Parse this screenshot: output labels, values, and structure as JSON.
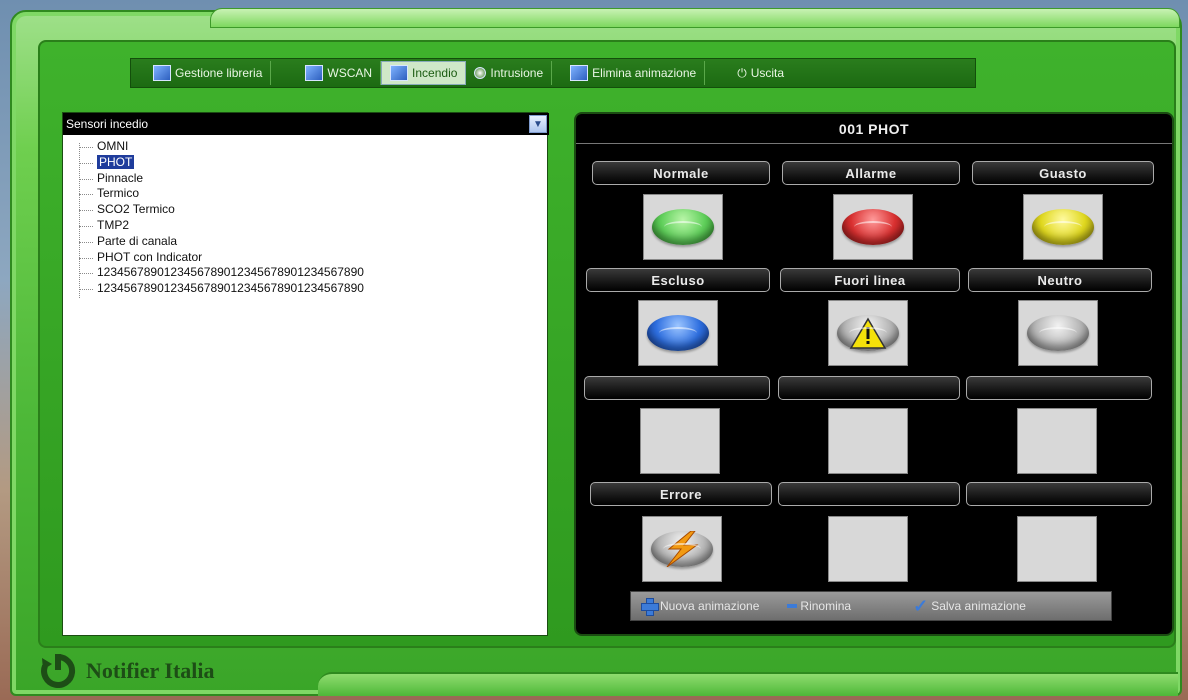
{
  "toolbar": {
    "items": [
      {
        "label": "Gestione libreria",
        "icon": "library-icon"
      },
      {
        "label": "WSCAN",
        "icon": "wscan-icon"
      },
      {
        "label": "Incendio",
        "icon": "fire-panel-icon"
      },
      {
        "label": "Intrusione",
        "icon": "intrusion-icon"
      },
      {
        "label": "Elimina animazione",
        "icon": "delete-animation-icon"
      }
    ],
    "active_index": 2,
    "exit_label": "Uscita"
  },
  "left_panel": {
    "combo_value": "Sensori incedio",
    "tree_items": [
      "OMNI",
      "PHOT",
      "Pinnacle",
      "Termico",
      "SCO2 Termico",
      "TMP2",
      "Parte di canala",
      "PHOT con Indicator",
      "123456789012345678901234567890123456789​0",
      "123456789012345678901234567890123456789​0"
    ],
    "selected_index": 1
  },
  "right_panel": {
    "title": "001 PHOT",
    "states": [
      {
        "label": "Normale",
        "icon": "green-detector"
      },
      {
        "label": "Allarme",
        "icon": "red-detector"
      },
      {
        "label": "Guasto",
        "icon": "yellow-detector"
      },
      {
        "label": "Escluso",
        "icon": "blue-detector"
      },
      {
        "label": "Fuori linea",
        "icon": "warning-detector"
      },
      {
        "label": "Neutro",
        "icon": "gray-detector"
      },
      {
        "label": "",
        "icon": ""
      },
      {
        "label": "",
        "icon": ""
      },
      {
        "label": "",
        "icon": ""
      },
      {
        "label": "Errore",
        "icon": "lightning-detector"
      },
      {
        "label": "",
        "icon": ""
      },
      {
        "label": "",
        "icon": ""
      }
    ],
    "actions": {
      "new": "Nuova animazione",
      "rename": "Rinomina",
      "save": "Salva animazione"
    }
  },
  "footer": {
    "brand": "Notifier Italia"
  },
  "colors": {
    "frame_green": "#4db838",
    "selection_blue": "#1f3c9c",
    "normal": "#5fcf5a",
    "alarm": "#d93030",
    "fault": "#e0d81e",
    "excluded": "#2e6fe0",
    "neutral": "#b8b8b8"
  }
}
